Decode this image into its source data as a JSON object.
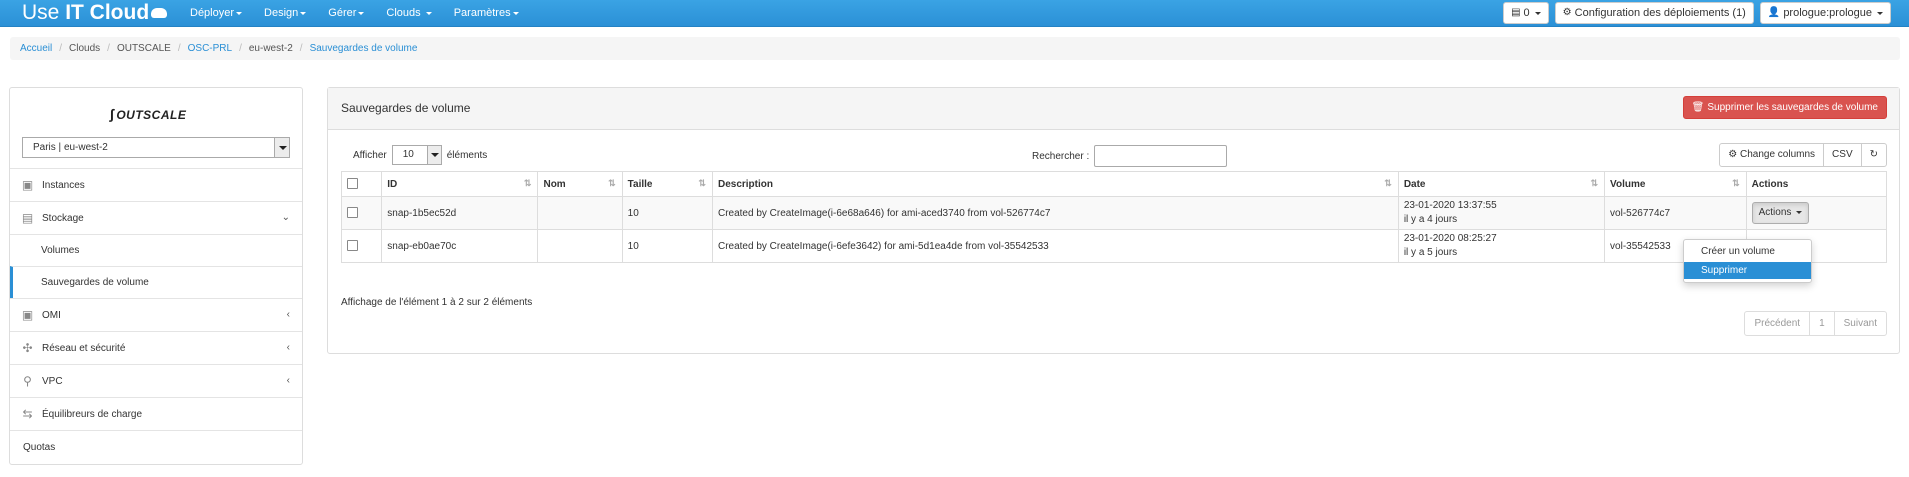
{
  "navbar": {
    "brand_light": "Use ",
    "brand_bold": "IT Cloud",
    "menu": [
      {
        "label": "Déployer"
      },
      {
        "label": "Design"
      },
      {
        "label": "Gérer"
      },
      {
        "label": "Clouds"
      },
      {
        "label": "Paramètres"
      }
    ],
    "notifications_count": "0",
    "config_label": "Configuration des déploiements (1)",
    "user_label": "prologue:prologue"
  },
  "breadcrumb": [
    {
      "label": "Accueil",
      "link": true
    },
    {
      "label": "Clouds",
      "link": false
    },
    {
      "label": "OUTSCALE",
      "link": false
    },
    {
      "label": "OSC-PRL",
      "link": true
    },
    {
      "label": "eu-west-2",
      "link": false
    },
    {
      "label": "Sauvegardes de volume",
      "link": true
    }
  ],
  "sidebar": {
    "logo_text": "OUTSCALE",
    "region": "Paris | eu-west-2",
    "items": [
      {
        "label": "Instances",
        "icon": "chip-icon"
      },
      {
        "label": "Stockage",
        "icon": "storage-icon"
      },
      {
        "label": "Volumes"
      },
      {
        "label": "Sauvegardes de volume"
      },
      {
        "label": "OMI",
        "icon": "chip-icon"
      },
      {
        "label": "Réseau et sécurité",
        "icon": "network-icon"
      },
      {
        "label": "VPC",
        "icon": "lock-icon"
      },
      {
        "label": "Équilibreurs de charge",
        "icon": "arrows-icon"
      },
      {
        "label": "Quotas"
      }
    ]
  },
  "panel": {
    "title": "Sauvegardes de volume",
    "delete_all_label": "Supprimer les sauvegardes de volume",
    "show_label": "Afficher",
    "page_length": "10",
    "entries_label": "éléments",
    "search_label": "Rechercher :",
    "search_value": "",
    "change_columns_label": "Change columns",
    "csv_label": "CSV",
    "columns": [
      "ID",
      "Nom",
      "Taille",
      "Description",
      "Date",
      "Volume",
      "Actions"
    ],
    "rows": [
      {
        "id": "snap-1b5ec52d",
        "name": "",
        "size": "10",
        "description": "Created by CreateImage(i-6e68a646) for ami-aced3740 from vol-526774c7",
        "date": "23-01-2020 13:37:55",
        "ago": "il y a 4 jours",
        "volume": "vol-526774c7"
      },
      {
        "id": "snap-eb0ae70c",
        "name": "",
        "size": "10",
        "description": "Created by CreateImage(i-6efe3642) for ami-5d1ea4de from vol-35542533",
        "date": "23-01-2020 08:25:27",
        "ago": "il y a 5 jours",
        "volume": "vol-35542533"
      }
    ],
    "actions_label": "Actions",
    "dropdown": {
      "create_volume": "Créer un volume",
      "delete": "Supprimer"
    },
    "info": "Affichage de l'élément 1 à 2 sur 2 éléments",
    "pagination": {
      "previous": "Précédent",
      "current": "1",
      "next": "Suivant"
    }
  },
  "colors": {
    "navbar": "#2b90d6",
    "link": "#2a8fd5",
    "danger": "#d9534f"
  }
}
